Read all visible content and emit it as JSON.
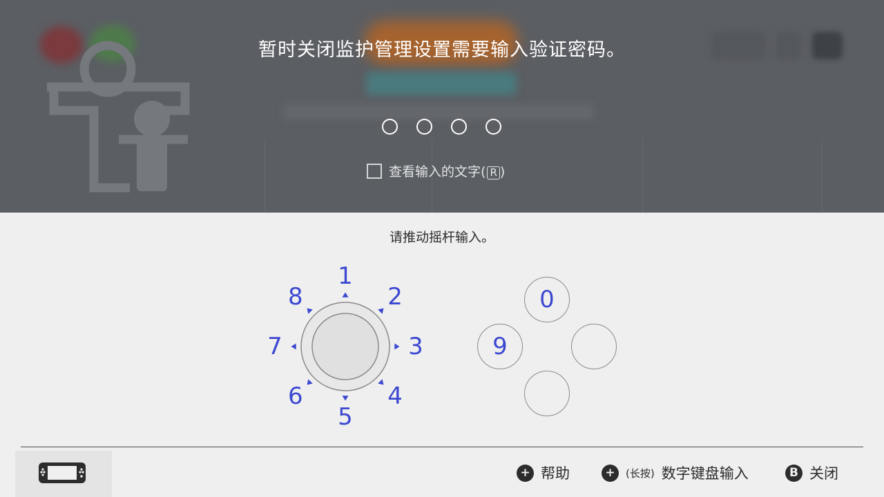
{
  "header": {
    "title": "暂时关闭监护管理设置需要输入验证密码。",
    "pin_digits": [
      "",
      "",
      "",
      ""
    ],
    "show_text_label": "查看输入的文字",
    "show_text_button": "R",
    "show_text_checked": false
  },
  "keypad": {
    "instruction": "请推动摇杆输入。",
    "stick_numbers": [
      "1",
      "2",
      "3",
      "4",
      "5",
      "6",
      "7",
      "8"
    ],
    "face_buttons": {
      "top": "0",
      "left": "9",
      "right": "",
      "bottom": ""
    },
    "accent_color": "#3c48d0"
  },
  "footer": {
    "help_label": "帮助",
    "help_button": "+",
    "long_press_label": "(长按)",
    "numpad_label": "数字键盘输入",
    "numpad_button": "+",
    "close_label": "关闭",
    "close_button": "B",
    "console_icon": "handheld-console-icon"
  }
}
